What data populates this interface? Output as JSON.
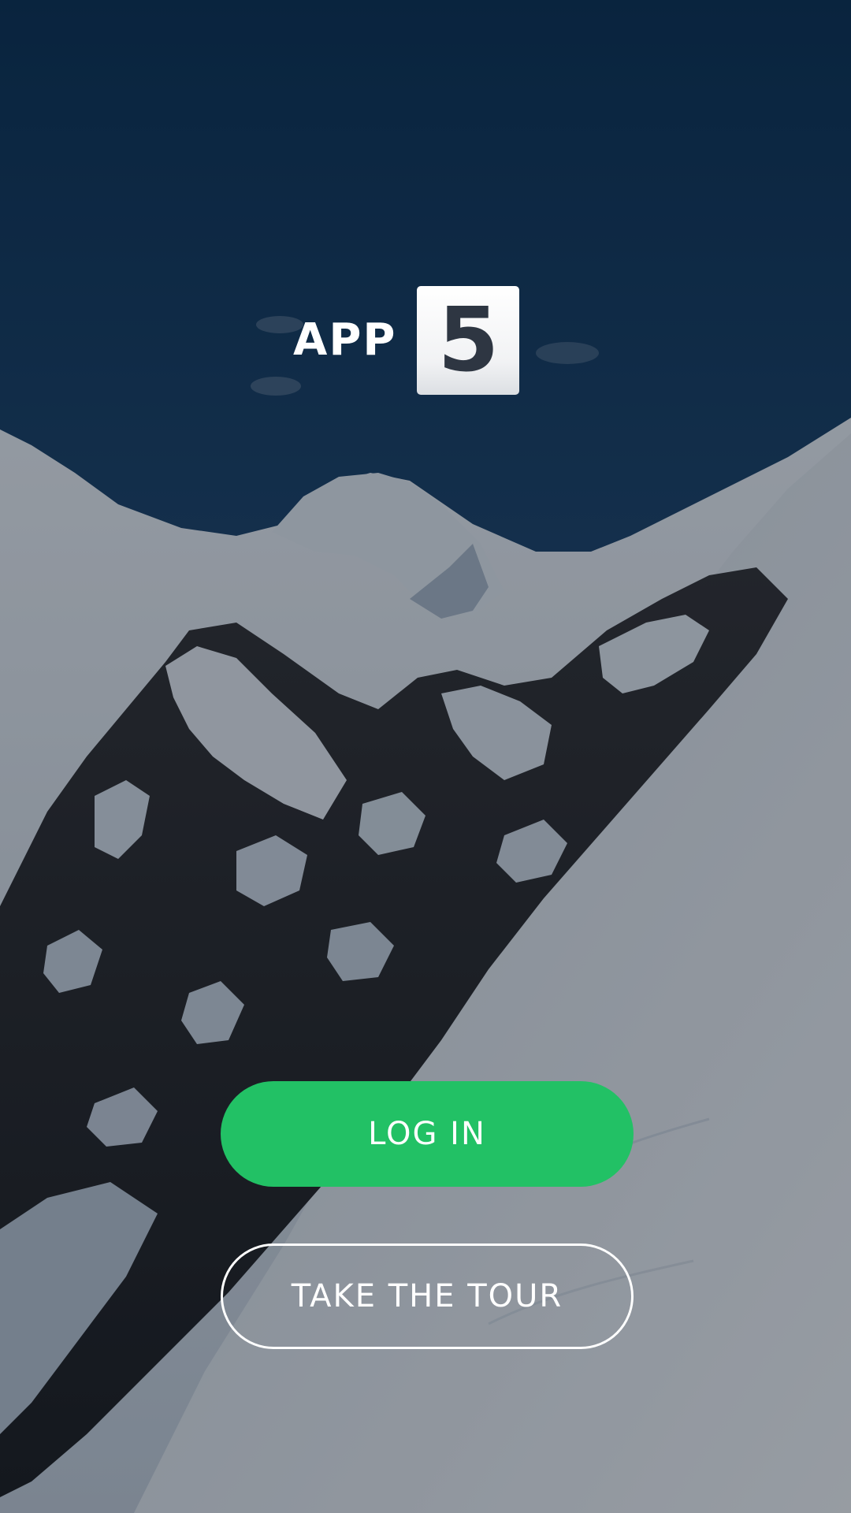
{
  "brand": {
    "name": "APP",
    "badge_number": "5"
  },
  "actions": {
    "login_label": "LOG IN",
    "tour_label": "TAKE THE TOUR"
  },
  "colors": {
    "login_button": "#22c165",
    "tour_button_border": "#ffffff",
    "sky_top": "#01284d",
    "sky_bottom": "#30496a"
  },
  "background": {
    "icon": "snowy-mountain-landscape"
  }
}
